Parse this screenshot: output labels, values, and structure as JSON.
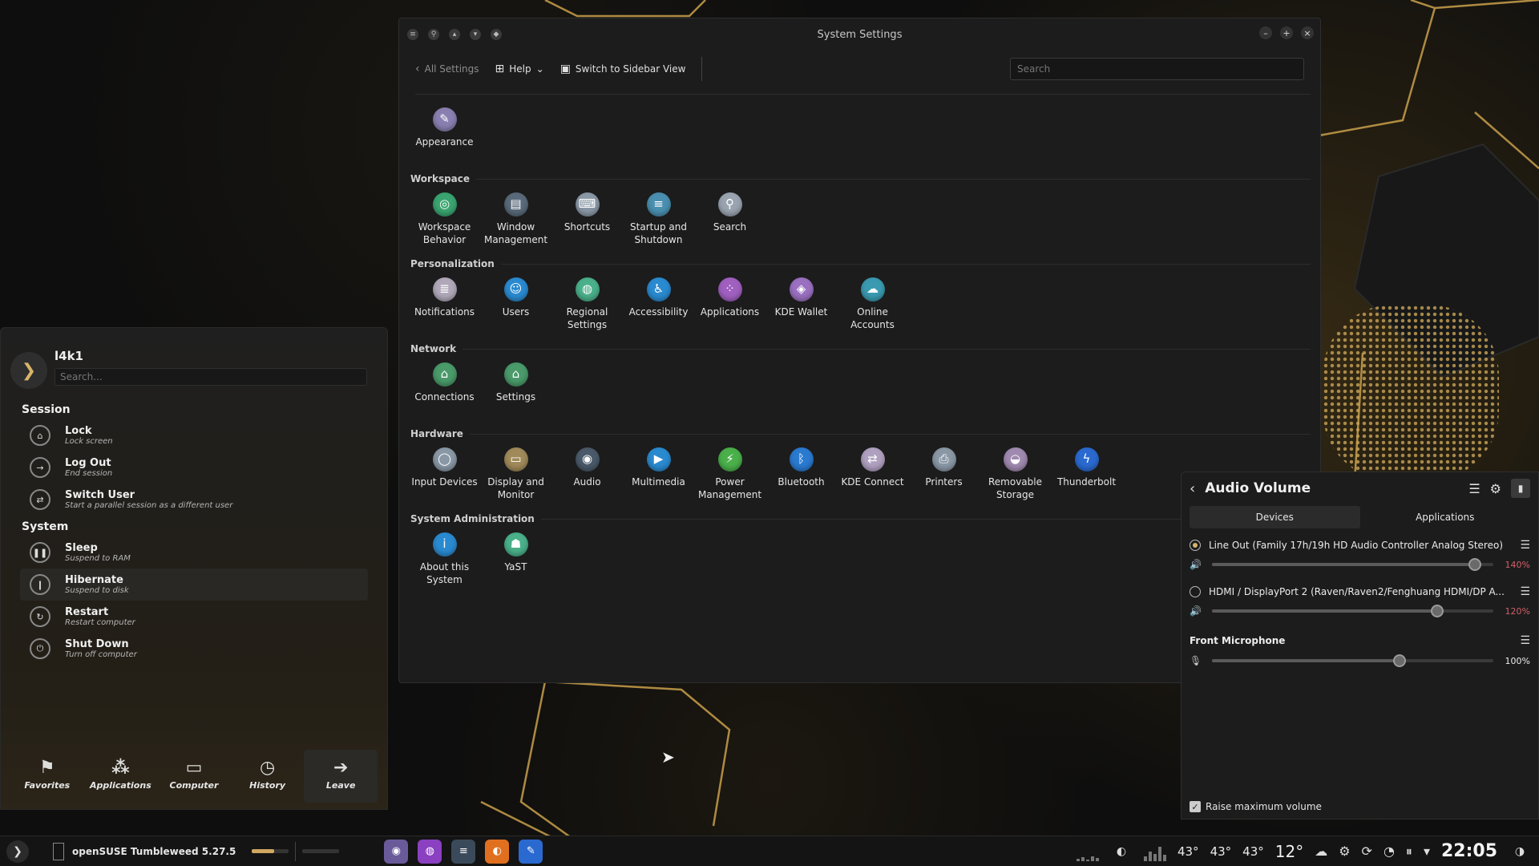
{
  "settings_window": {
    "title": "System Settings",
    "toolbar": {
      "all_settings": "All Settings",
      "help": "Help",
      "switch_view": "Switch to Sidebar View",
      "search_placeholder": "Search"
    },
    "top_item": {
      "label": "Appearance",
      "icon": "appearance-icon",
      "color": "#8a7fb0"
    },
    "sections": [
      {
        "title": "Workspace",
        "items": [
          {
            "label": "Workspace Behavior",
            "icon": "workspace-behavior-icon",
            "color": "#3aa570"
          },
          {
            "label": "Window Management",
            "icon": "window-management-icon",
            "color": "#5a6a7a"
          },
          {
            "label": "Shortcuts",
            "icon": "shortcuts-icon",
            "color": "#8a98a6"
          },
          {
            "label": "Startup and Shutdown",
            "icon": "startup-shutdown-icon",
            "color": "#4a8fb0"
          },
          {
            "label": "Search",
            "icon": "search-icon",
            "color": "#9aa4b0"
          }
        ]
      },
      {
        "title": "Personalization",
        "items": [
          {
            "label": "Notifications",
            "icon": "notifications-icon",
            "color": "#b0a8b8"
          },
          {
            "label": "Users",
            "icon": "users-icon",
            "color": "#2a8ad0"
          },
          {
            "label": "Regional Settings",
            "icon": "regional-settings-icon",
            "color": "#4ab08a"
          },
          {
            "label": "Accessibility",
            "icon": "accessibility-icon",
            "color": "#2a8ad0"
          },
          {
            "label": "Applications",
            "icon": "applications-icon",
            "color": "#a060c0"
          },
          {
            "label": "KDE Wallet",
            "icon": "kde-wallet-icon",
            "color": "#9a70c0"
          },
          {
            "label": "Online Accounts",
            "icon": "online-accounts-icon",
            "color": "#3a9ab0"
          }
        ]
      },
      {
        "title": "Network",
        "items": [
          {
            "label": "Connections",
            "icon": "connections-icon",
            "color": "#4a9a6a"
          },
          {
            "label": "Settings",
            "icon": "network-settings-icon",
            "color": "#4a9a6a"
          }
        ]
      },
      {
        "title": "Hardware",
        "items": [
          {
            "label": "Input Devices",
            "icon": "input-devices-icon",
            "color": "#8a98a6"
          },
          {
            "label": "Display and Monitor",
            "icon": "display-monitor-icon",
            "color": "#a08a5a"
          },
          {
            "label": "Audio",
            "icon": "audio-icon",
            "color": "#4a5a6a"
          },
          {
            "label": "Multimedia",
            "icon": "multimedia-icon",
            "color": "#2a8ad0"
          },
          {
            "label": "Power Management",
            "icon": "power-management-icon",
            "color": "#4ab04a"
          },
          {
            "label": "Bluetooth",
            "icon": "bluetooth-icon",
            "color": "#2a7ad0"
          },
          {
            "label": "KDE Connect",
            "icon": "kde-connect-icon",
            "color": "#b0a0c0"
          },
          {
            "label": "Printers",
            "icon": "printers-icon",
            "color": "#8a98a6"
          },
          {
            "label": "Removable Storage",
            "icon": "removable-storage-icon",
            "color": "#a08ab0"
          },
          {
            "label": "Thunderbolt",
            "icon": "thunderbolt-icon",
            "color": "#2a6ad0"
          }
        ]
      },
      {
        "title": "System Administration",
        "items": [
          {
            "label": "About this System",
            "icon": "about-system-icon",
            "color": "#2a8ad0"
          },
          {
            "label": "YaST",
            "icon": "yast-icon",
            "color": "#4ab08a"
          }
        ]
      }
    ]
  },
  "launcher": {
    "user": "l4k1",
    "search_placeholder": "Search...",
    "groups": [
      {
        "title": "Session",
        "items": [
          {
            "label": "Lock",
            "desc": "Lock screen",
            "icon": "lock-icon"
          },
          {
            "label": "Log Out",
            "desc": "End session",
            "icon": "logout-icon"
          },
          {
            "label": "Switch User",
            "desc": "Start a parallel session as a different user",
            "icon": "switch-user-icon"
          }
        ]
      },
      {
        "title": "System",
        "items": [
          {
            "label": "Sleep",
            "desc": "Suspend to RAM",
            "icon": "sleep-icon"
          },
          {
            "label": "Hibernate",
            "desc": "Suspend to disk",
            "icon": "hibernate-icon",
            "highlight": true
          },
          {
            "label": "Restart",
            "desc": "Restart computer",
            "icon": "restart-icon"
          },
          {
            "label": "Shut Down",
            "desc": "Turn off computer",
            "icon": "shutdown-icon"
          }
        ]
      }
    ],
    "tabs": [
      {
        "label": "Favorites",
        "icon": "favorites-icon"
      },
      {
        "label": "Applications",
        "icon": "applications-grid-icon"
      },
      {
        "label": "Computer",
        "icon": "computer-icon"
      },
      {
        "label": "History",
        "icon": "history-icon"
      },
      {
        "label": "Leave",
        "icon": "leave-icon",
        "active": true
      }
    ]
  },
  "audio": {
    "title": "Audio Volume",
    "tabs": [
      {
        "label": "Devices",
        "active": true
      },
      {
        "label": "Applications"
      }
    ],
    "outputs": [
      {
        "name": "Line Out (Family 17h/19h HD Audio Controller Analog Stereo)",
        "percent": "140%",
        "level": 1.4,
        "selected": true
      },
      {
        "name": "HDMI / DisplayPort 2 (Raven/Raven2/Fenghuang HDMI/DP A...",
        "percent": "120%",
        "level": 1.2,
        "selected": false
      }
    ],
    "mic": {
      "name": "Front Microphone",
      "percent": "100%",
      "level": 1.0
    },
    "max_level": 1.5,
    "raise_label": "Raise maximum volume"
  },
  "taskbar": {
    "distro": "openSUSE Tumbleweed 5.27.5",
    "temps": [
      "43°",
      "43°",
      "43°"
    ],
    "weather": "12°",
    "clock": "22:05",
    "apps": [
      {
        "icon": "discover-icon",
        "color": "#6a5a9a",
        "active": true
      },
      {
        "icon": "shop-icon",
        "color": "#8a40c0",
        "active": false
      },
      {
        "icon": "system-settings-icon",
        "color": "#3a4a5a",
        "active": true
      },
      {
        "icon": "firefox-icon",
        "color": "#e07020",
        "active": false
      },
      {
        "icon": "krita-icon",
        "color": "#2a6ad0",
        "active": true
      }
    ]
  }
}
